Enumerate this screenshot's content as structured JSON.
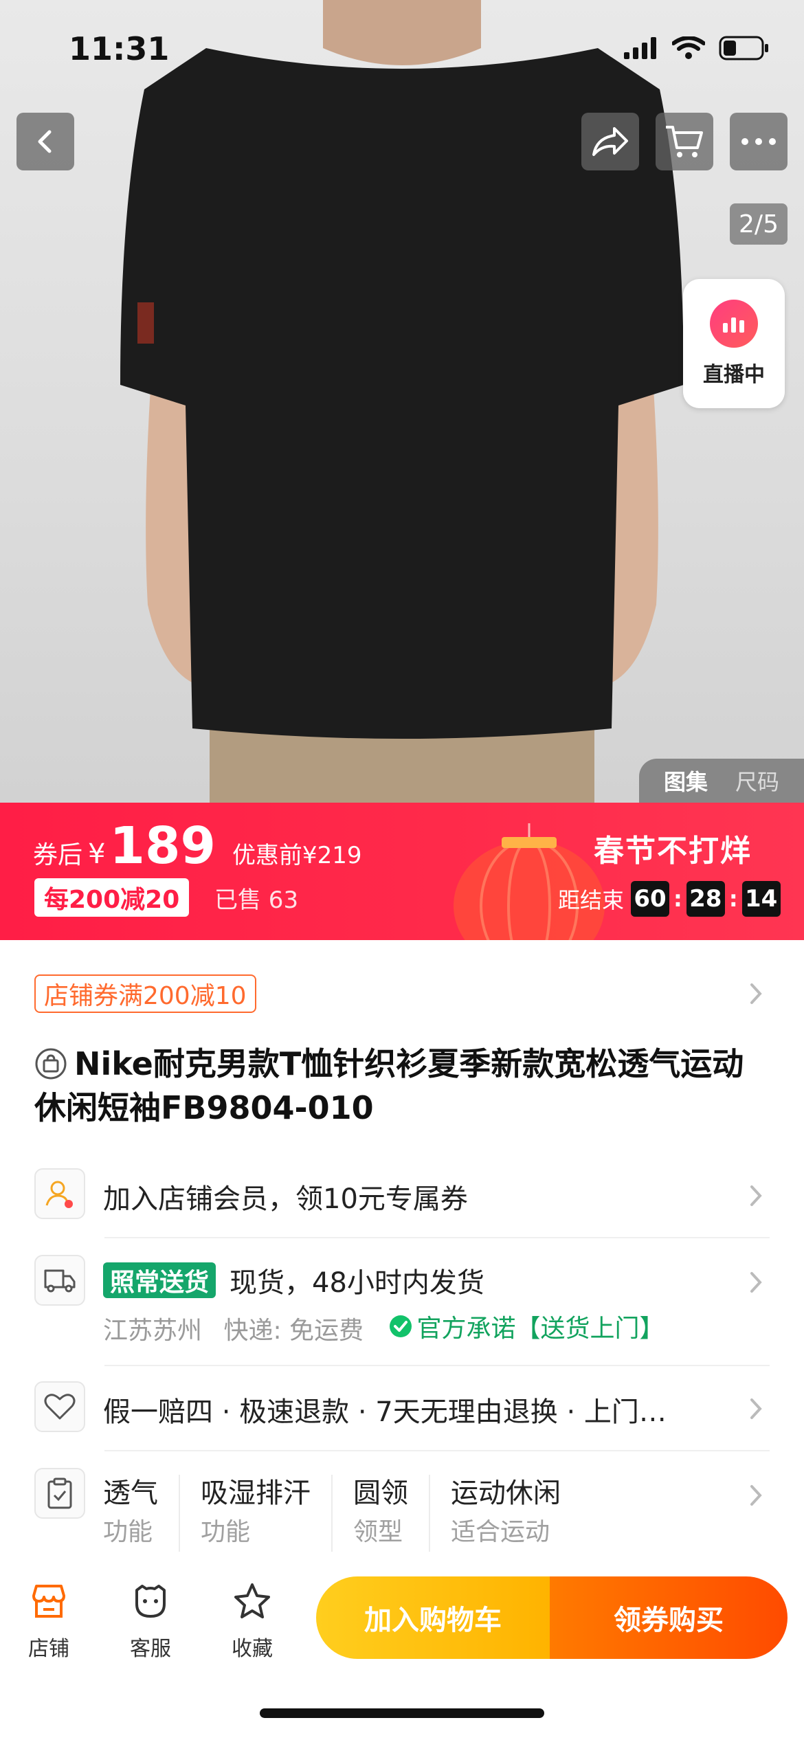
{
  "status_bar": {
    "time": "11:31"
  },
  "gallery": {
    "page_indicator": "2/5",
    "live_label": "直播中",
    "tab_gallery": "图集",
    "tab_size": "尺码"
  },
  "price": {
    "prefix": "券后",
    "currency": "¥",
    "amount": "189",
    "original": "优惠前¥219",
    "promo": "每200减20",
    "sold": "已售 63",
    "sale_title": "春节不打烊",
    "countdown_label": "距结束",
    "countdown": [
      "60",
      "28",
      "14"
    ]
  },
  "coupon": {
    "label": "店铺券满200减10"
  },
  "product": {
    "title": "Nike耐克男款T恤针织衫夏季新款宽松透气运动休闲短袖FB9804-010"
  },
  "member": {
    "text": "加入店铺会员，领10元专属券"
  },
  "shipping": {
    "badge": "照常送货",
    "text": "现货，48小时内发货",
    "origin": "江苏苏州",
    "express": "快递: 免运费",
    "promise": "官方承诺【送货上门】"
  },
  "guarantee": {
    "text": "假一赔四 · 极速退款 · 7天无理由退换 · 上门…"
  },
  "attributes": [
    {
      "value": "透气",
      "key": "功能"
    },
    {
      "value": "吸湿排汗",
      "key": "功能"
    },
    {
      "value": "圆领",
      "key": "领型"
    },
    {
      "value": "运动休闲",
      "key": "适合运动"
    }
  ],
  "bottom_bar": {
    "store": "店铺",
    "service": "客服",
    "favorite": "收藏",
    "add_cart": "加入购物车",
    "buy": "领券购买"
  },
  "colors": {
    "accent_red": "#ff1e46",
    "orange": "#ff6a2e",
    "green": "#15a66b",
    "yellow": "#ffc107"
  }
}
